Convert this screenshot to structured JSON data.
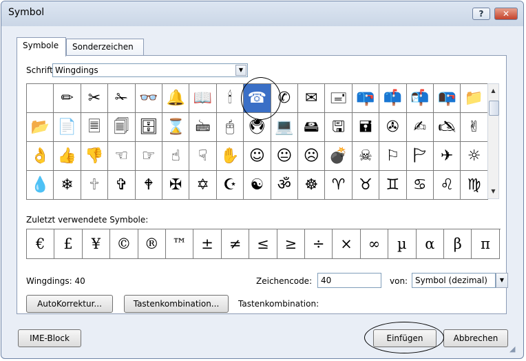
{
  "window": {
    "title": "Symbol",
    "help_label": "?",
    "close_label": "✕"
  },
  "tabs": [
    {
      "label": "Symbole"
    },
    {
      "label": "Sonderzeichen"
    }
  ],
  "font": {
    "label": "Schriftart:",
    "value": "Wingdings"
  },
  "grid": {
    "selected_index": 8,
    "rows": [
      [
        "",
        "✏",
        "✂",
        "✁",
        "👓",
        "🔔",
        "📖",
        "🕯",
        "☎",
        "✆",
        "✉",
        "🖃",
        "📪",
        "📫",
        "📬",
        "📭",
        "📁"
      ],
      [
        "📂",
        "📄",
        "🗏",
        "🗐",
        "🗄",
        "⌛",
        "🖮",
        "🖰",
        "🖲",
        "💻",
        "🖴",
        "🖫",
        "🖬",
        "✇",
        "✍",
        "🖎",
        "✌"
      ],
      [
        "👌",
        "👍",
        "👎",
        "☜",
        "☞",
        "☝",
        "☟",
        "✋",
        "☺",
        "😐",
        "☹",
        "💣",
        "☠",
        "⚐",
        "🏱",
        "✈",
        "☼"
      ],
      [
        "💧",
        "❄",
        "🕆",
        "✞",
        "🕈",
        "✠",
        "✡",
        "☪",
        "☯",
        "ॐ",
        "☸",
        "♈",
        "♉",
        "♊",
        "♋",
        "♌",
        "♍"
      ]
    ]
  },
  "recent": {
    "label": "Zuletzt verwendete Symbole:",
    "symbols": [
      "€",
      "£",
      "¥",
      "©",
      "®",
      "™",
      "±",
      "≠",
      "≤",
      "≥",
      "÷",
      "×",
      "∞",
      "µ",
      "α",
      "β",
      "π"
    ]
  },
  "info": {
    "font_code_text": "Wingdings: 40"
  },
  "charcode": {
    "label": "Zeichencode:",
    "value": "40"
  },
  "from": {
    "label": "von:",
    "value": "Symbol (dezimal)"
  },
  "buttons": {
    "autocorrect": "AutoKorrektur...",
    "shortcut_key": "Tastenkombination...",
    "shortcut_label": "Tastenkombination:",
    "ime_block": "IME-Block",
    "insert": "Einfügen",
    "cancel": "Abbrechen"
  },
  "icons": {
    "scroll_up": "scroll-up-arrow-icon",
    "scroll_down": "scroll-down-arrow-icon",
    "dropdown": "chevron-down-icon",
    "resize": "resize-grip-icon"
  }
}
